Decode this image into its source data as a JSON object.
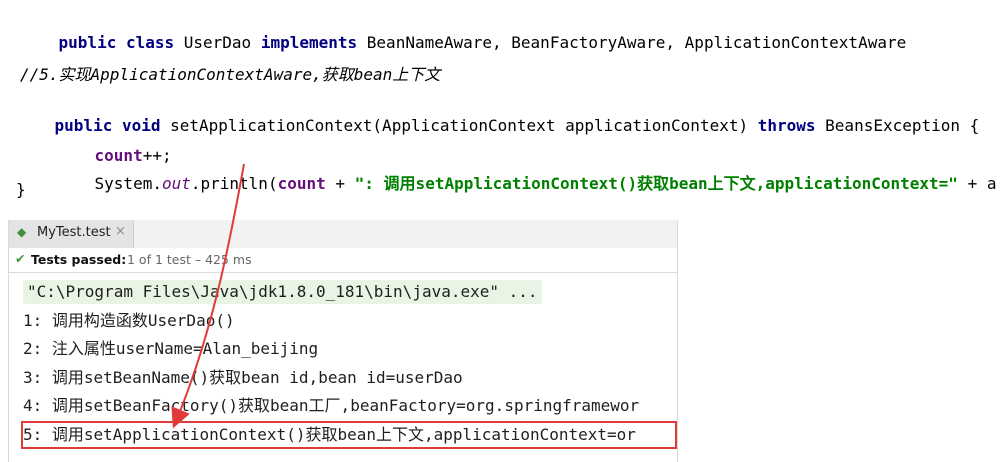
{
  "editor": {
    "line1": {
      "kw1": "public class",
      "name": " UserDao ",
      "kw2": "implements",
      "rest": " BeanNameAware, BeanFactoryAware, ApplicationContextAware"
    },
    "comment": "//5.实现ApplicationContextAware,获取bean上下文",
    "method": {
      "kw": "public void",
      "sig": " setApplicationContext(ApplicationContext applicationContext) ",
      "throws_kw": "throws",
      "throws_rest": " BeansException {"
    },
    "count_field": "count",
    "count_op": "++;",
    "println": {
      "cls": "System.",
      "out": "out",
      "call": ".println(",
      "field": "count",
      "plus": " + ",
      "str": "\": 调用setApplicationContext()获取bean上下文,applicationContext=\"",
      "tail": " + a"
    },
    "close_brace": "}"
  },
  "run_panel": {
    "tab_label": "MyTest.test",
    "tab_close": "×",
    "status_label": "Tests passed:",
    "status_detail": "1 of 1 test – 425 ms",
    "console_lines": [
      "\"C:\\Program Files\\Java\\jdk1.8.0_181\\bin\\java.exe\" ...",
      "1: 调用构造函数UserDao()",
      "2: 注入属性userName=Alan_beijing",
      "3: 调用setBeanName()获取bean id,bean id=userDao",
      "4: 调用setBeanFactory()获取bean工厂,beanFactory=org.springframewor",
      "5: 调用setApplicationContext()获取bean上下文,applicationContext=or"
    ]
  },
  "colors": {
    "keyword": "#000080",
    "string": "#008000",
    "comment": "#808080",
    "highlight_box": "#e03a3a",
    "arrow": "#e03a3a"
  },
  "icons": {
    "tab": "run-test-icon",
    "status": "check-icon",
    "close": "close-icon"
  }
}
